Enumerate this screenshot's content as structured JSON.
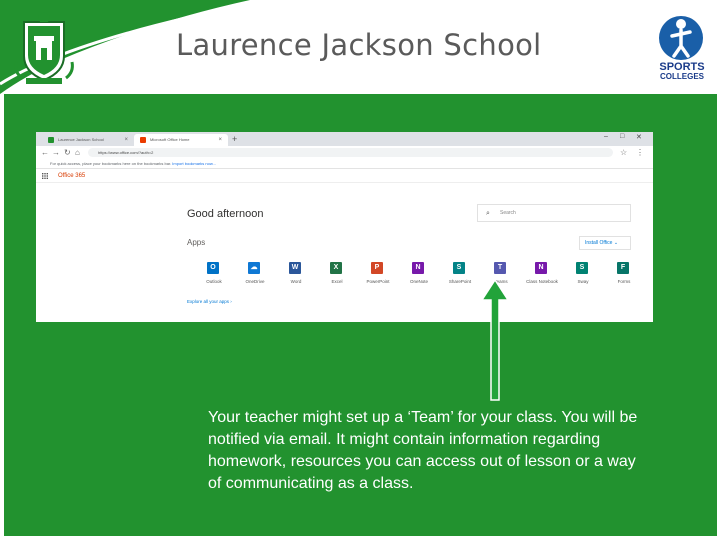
{
  "header": {
    "school_name": "Laurence Jackson School",
    "sports_logo": {
      "line1": "SPORTS",
      "line2": "COLLEGES"
    }
  },
  "browser": {
    "tabs": [
      {
        "label": "Laurence Jackson School",
        "active": false
      },
      {
        "label": "Microsoft Office Home",
        "active": true
      }
    ],
    "address": "https://www.office.com/?auth=2",
    "bookmarks_text": "For quick access, place your bookmarks here on the bookmarks bar.",
    "bookmarks_link": "Import bookmarks now...",
    "suite_name": "Office 365"
  },
  "office": {
    "greeting": "Good afternoon",
    "search_placeholder": "Search",
    "apps_label": "Apps",
    "install_label": "Install Office",
    "explore_label": "Explore all your apps",
    "apps": [
      {
        "name": "Outlook",
        "letter": "O",
        "color": "#0072c6"
      },
      {
        "name": "OneDrive",
        "letter": "☁",
        "color": "#0f78d4"
      },
      {
        "name": "Word",
        "letter": "W",
        "color": "#2b579a"
      },
      {
        "name": "Excel",
        "letter": "X",
        "color": "#217346"
      },
      {
        "name": "PowerPoint",
        "letter": "P",
        "color": "#d24726"
      },
      {
        "name": "OneNote",
        "letter": "N",
        "color": "#7719aa"
      },
      {
        "name": "SharePoint",
        "letter": "S",
        "color": "#038387"
      },
      {
        "name": "Teams",
        "letter": "T",
        "color": "#5558af"
      },
      {
        "name": "Class Notebook",
        "letter": "N",
        "color": "#7719aa"
      },
      {
        "name": "Sway",
        "letter": "S",
        "color": "#008272"
      },
      {
        "name": "Forms",
        "letter": "F",
        "color": "#077568"
      }
    ]
  },
  "caption": "Your teacher might set up a ‘Team’ for your class. You will be notified via email. It might contain information regarding homework, resources you can access out of lesson or a way of communicating as a class.",
  "colors": {
    "panel": "#22922f",
    "arrow": "#22a33a",
    "title": "#5a5a5a"
  }
}
